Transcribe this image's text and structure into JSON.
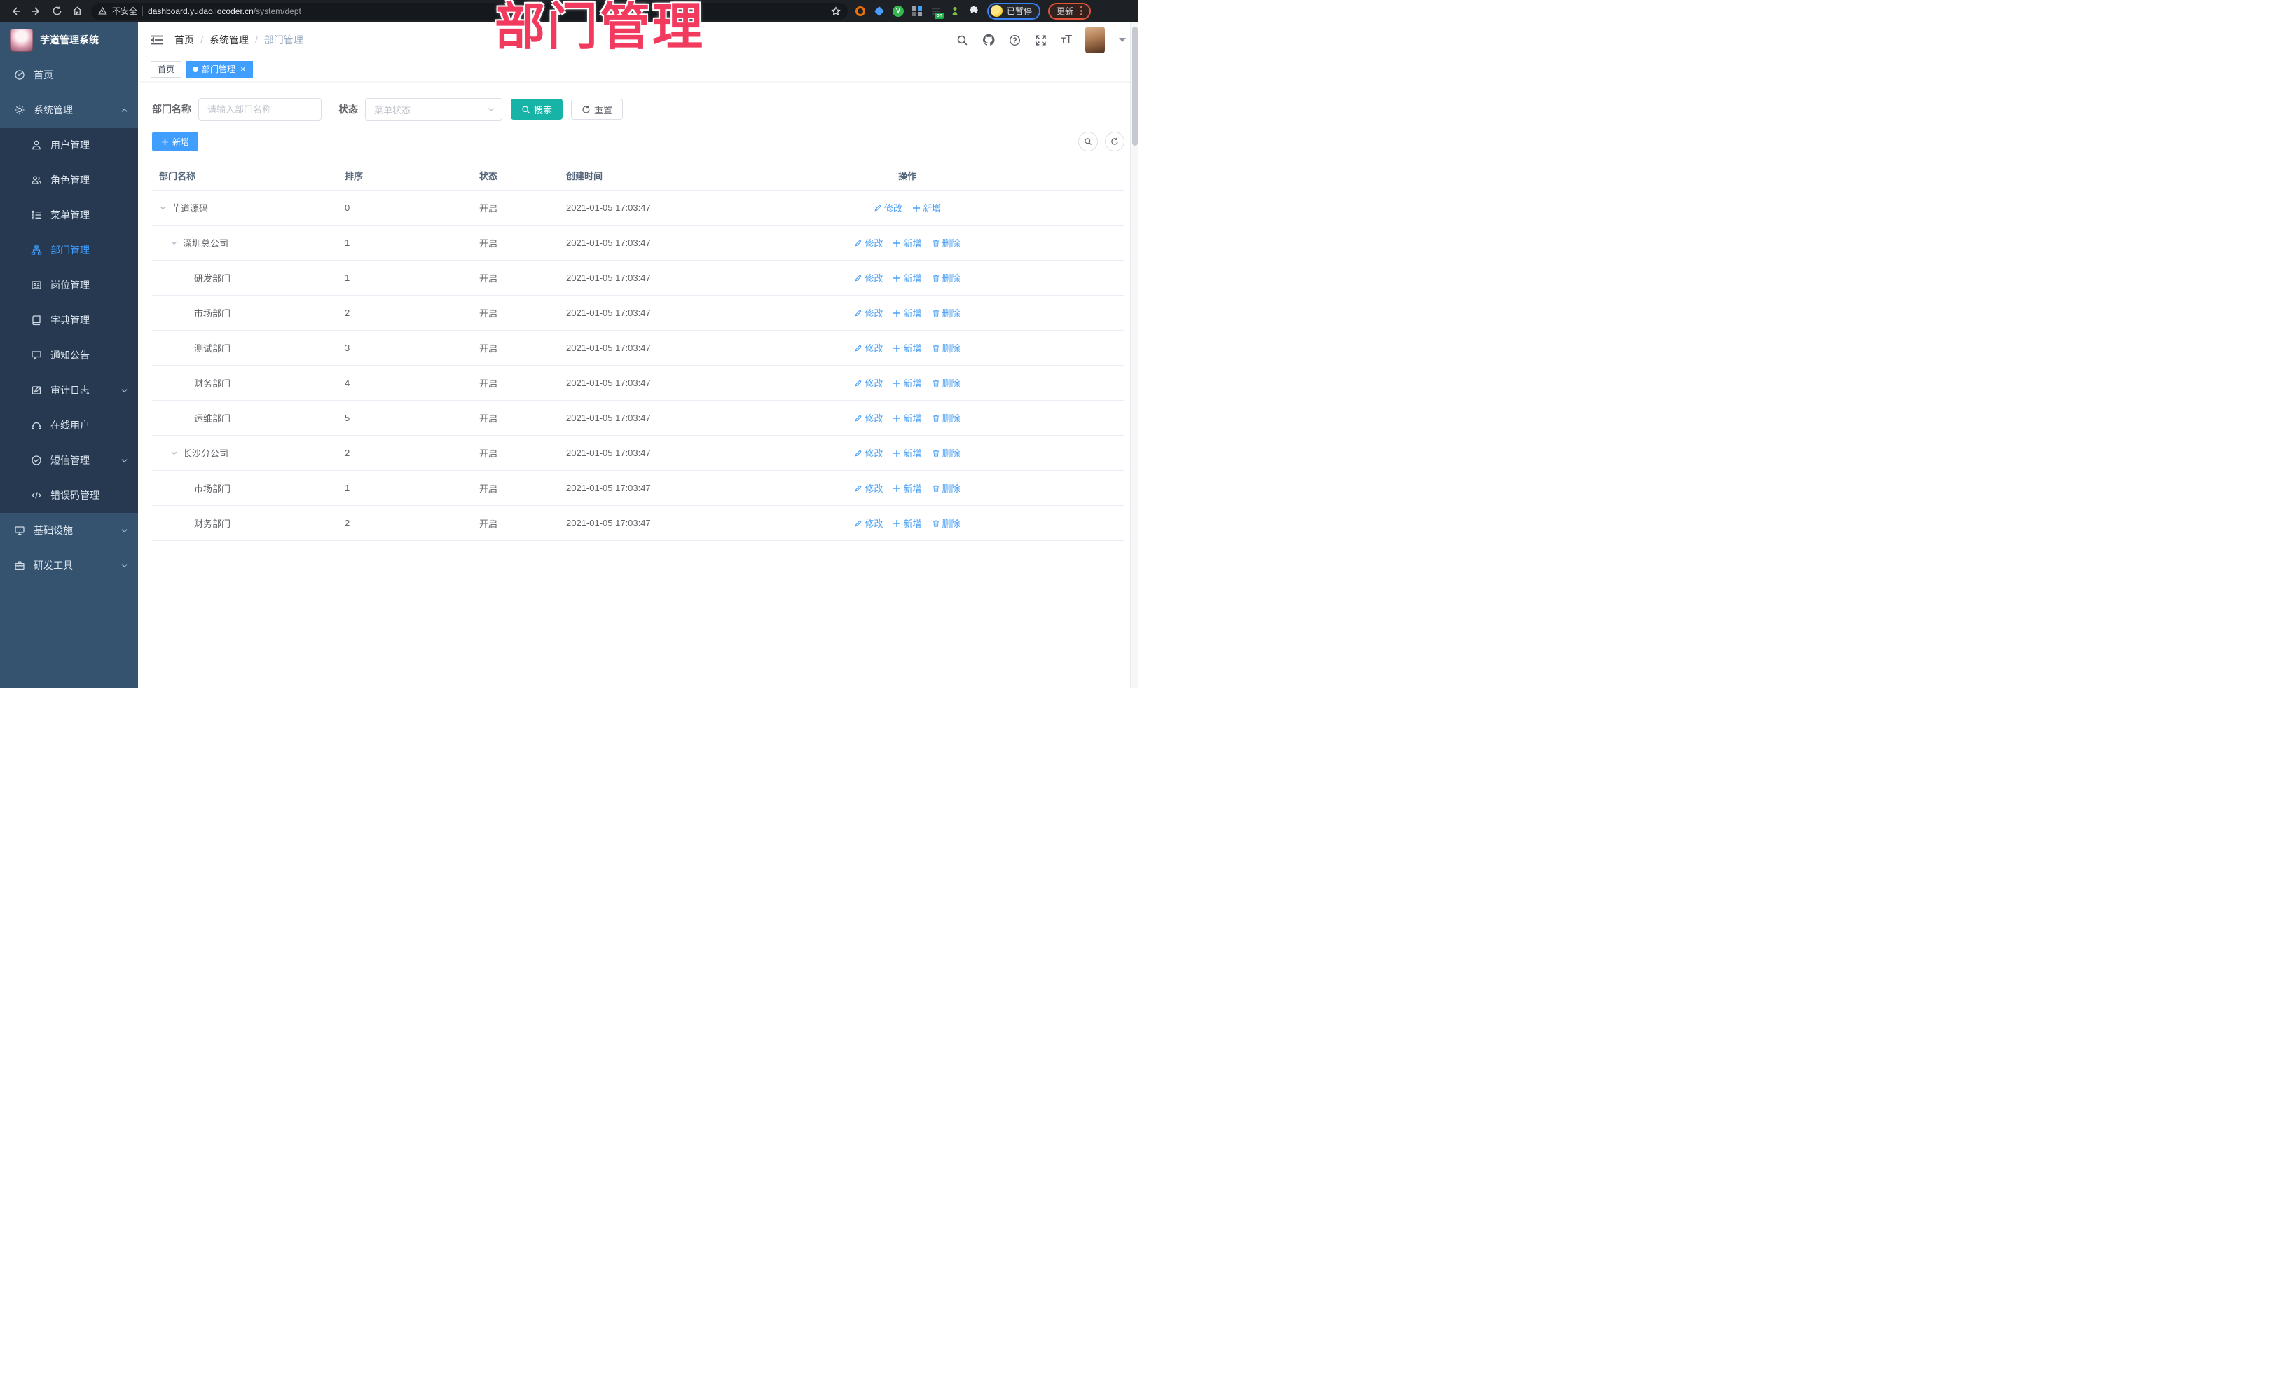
{
  "browser": {
    "security_label": "不安全",
    "url_host": "dashboard.yudao.iocoder.cn",
    "url_path": "/system/dept",
    "extension_badge": "on",
    "profile_label": "已暂停",
    "update_label": "更新"
  },
  "annotation": {
    "title": "部门管理"
  },
  "sidebar": {
    "app_title": "芋道管理系统",
    "items": [
      {
        "label": "首页",
        "icon": "dashboard-icon"
      },
      {
        "label": "系统管理",
        "icon": "gear-icon",
        "chevron": "up"
      },
      {
        "label": "用户管理",
        "icon": "user-icon"
      },
      {
        "label": "角色管理",
        "icon": "users-icon"
      },
      {
        "label": "菜单管理",
        "icon": "menu-list-icon"
      },
      {
        "label": "部门管理",
        "icon": "org-tree-icon",
        "active": true
      },
      {
        "label": "岗位管理",
        "icon": "id-badge-icon"
      },
      {
        "label": "字典管理",
        "icon": "book-icon"
      },
      {
        "label": "通知公告",
        "icon": "announcement-icon"
      },
      {
        "label": "审计日志",
        "icon": "audit-log-icon",
        "chevron": "down"
      },
      {
        "label": "在线用户",
        "icon": "online-user-icon"
      },
      {
        "label": "短信管理",
        "icon": "sms-icon",
        "chevron": "down"
      },
      {
        "label": "错误码管理",
        "icon": "code-icon"
      },
      {
        "label": "基础设施",
        "icon": "infrastructure-icon",
        "chevron": "down"
      },
      {
        "label": "研发工具",
        "icon": "dev-tools-icon",
        "chevron": "down"
      }
    ]
  },
  "breadcrumb": {
    "items": [
      "首页",
      "系统管理",
      "部门管理"
    ]
  },
  "tags": {
    "home": "首页",
    "current": "部门管理"
  },
  "filter": {
    "dept_label": "部门名称",
    "dept_placeholder": "请输入部门名称",
    "status_label": "状态",
    "status_placeholder": "菜单状态",
    "search_label": "搜索",
    "reset_label": "重置"
  },
  "toolbar": {
    "add_label": "新增"
  },
  "table": {
    "columns": [
      "部门名称",
      "排序",
      "状态",
      "创建时间",
      "操作"
    ],
    "action_labels": {
      "modify": "修改",
      "add": "新增",
      "delete": "删除"
    },
    "rows": [
      {
        "name": "芋道源码",
        "level": 0,
        "expandable": true,
        "sort": "0",
        "status": "开启",
        "created": "2021-01-05 17:03:47",
        "can_delete": false
      },
      {
        "name": "深圳总公司",
        "level": 1,
        "expandable": true,
        "sort": "1",
        "status": "开启",
        "created": "2021-01-05 17:03:47",
        "can_delete": true
      },
      {
        "name": "研发部门",
        "level": 2,
        "expandable": false,
        "sort": "1",
        "status": "开启",
        "created": "2021-01-05 17:03:47",
        "can_delete": true
      },
      {
        "name": "市场部门",
        "level": 2,
        "expandable": false,
        "sort": "2",
        "status": "开启",
        "created": "2021-01-05 17:03:47",
        "can_delete": true
      },
      {
        "name": "测试部门",
        "level": 2,
        "expandable": false,
        "sort": "3",
        "status": "开启",
        "created": "2021-01-05 17:03:47",
        "can_delete": true
      },
      {
        "name": "财务部门",
        "level": 2,
        "expandable": false,
        "sort": "4",
        "status": "开启",
        "created": "2021-01-05 17:03:47",
        "can_delete": true
      },
      {
        "name": "运维部门",
        "level": 2,
        "expandable": false,
        "sort": "5",
        "status": "开启",
        "created": "2021-01-05 17:03:47",
        "can_delete": true
      },
      {
        "name": "长沙分公司",
        "level": 1,
        "expandable": true,
        "sort": "2",
        "status": "开启",
        "created": "2021-01-05 17:03:47",
        "can_delete": true
      },
      {
        "name": "市场部门",
        "level": 2,
        "expandable": false,
        "sort": "1",
        "status": "开启",
        "created": "2021-01-05 17:03:47",
        "can_delete": true
      },
      {
        "name": "财务部门",
        "level": 2,
        "expandable": false,
        "sort": "2",
        "status": "开启",
        "created": "2021-01-05 17:03:47",
        "can_delete": true
      }
    ]
  },
  "colors": {
    "primary_blue": "#409eff",
    "search_button_teal": "#17b3a6",
    "action_link_blue": "#4ba0f5",
    "annotation_pink": "#f2395e",
    "sidebar_bg": "#35536f",
    "submenu_bg": "#263950"
  }
}
